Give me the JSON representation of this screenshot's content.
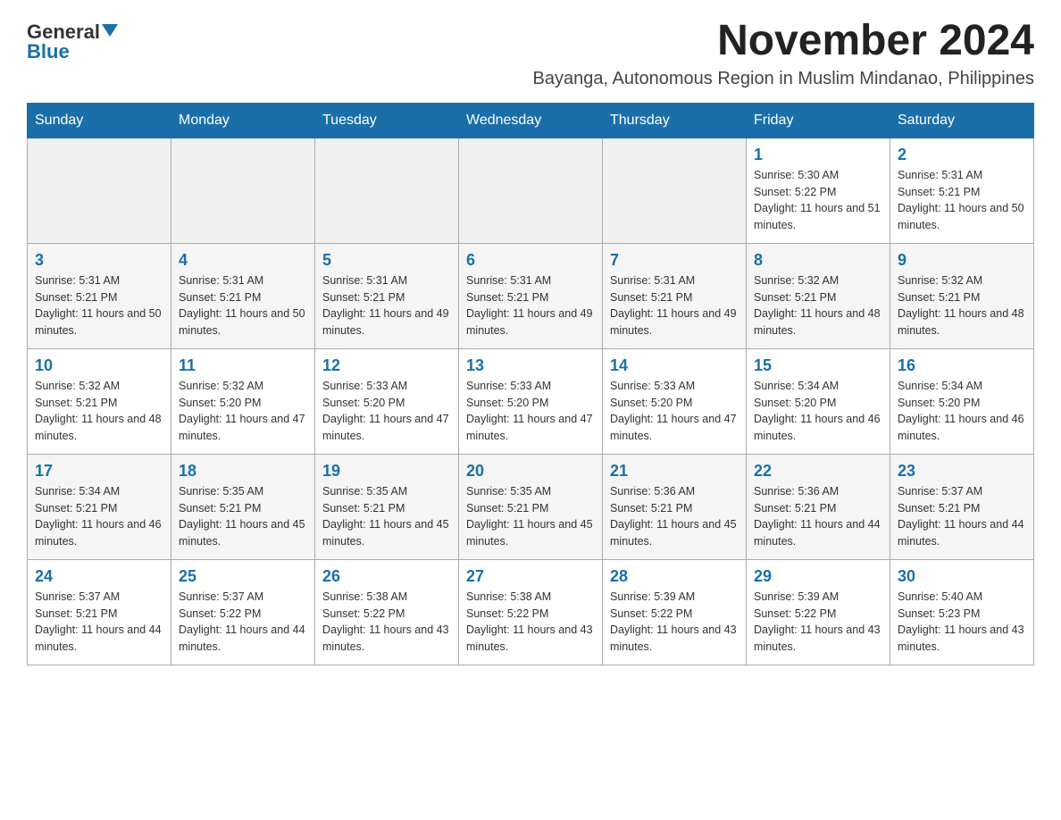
{
  "header": {
    "logo_general": "General",
    "logo_blue": "Blue",
    "title": "November 2024",
    "subtitle": "Bayanga, Autonomous Region in Muslim Mindanao, Philippines"
  },
  "weekdays": [
    "Sunday",
    "Monday",
    "Tuesday",
    "Wednesday",
    "Thursday",
    "Friday",
    "Saturday"
  ],
  "weeks": [
    [
      {
        "day": "",
        "info": ""
      },
      {
        "day": "",
        "info": ""
      },
      {
        "day": "",
        "info": ""
      },
      {
        "day": "",
        "info": ""
      },
      {
        "day": "",
        "info": ""
      },
      {
        "day": "1",
        "info": "Sunrise: 5:30 AM\nSunset: 5:22 PM\nDaylight: 11 hours and 51 minutes."
      },
      {
        "day": "2",
        "info": "Sunrise: 5:31 AM\nSunset: 5:21 PM\nDaylight: 11 hours and 50 minutes."
      }
    ],
    [
      {
        "day": "3",
        "info": "Sunrise: 5:31 AM\nSunset: 5:21 PM\nDaylight: 11 hours and 50 minutes."
      },
      {
        "day": "4",
        "info": "Sunrise: 5:31 AM\nSunset: 5:21 PM\nDaylight: 11 hours and 50 minutes."
      },
      {
        "day": "5",
        "info": "Sunrise: 5:31 AM\nSunset: 5:21 PM\nDaylight: 11 hours and 49 minutes."
      },
      {
        "day": "6",
        "info": "Sunrise: 5:31 AM\nSunset: 5:21 PM\nDaylight: 11 hours and 49 minutes."
      },
      {
        "day": "7",
        "info": "Sunrise: 5:31 AM\nSunset: 5:21 PM\nDaylight: 11 hours and 49 minutes."
      },
      {
        "day": "8",
        "info": "Sunrise: 5:32 AM\nSunset: 5:21 PM\nDaylight: 11 hours and 48 minutes."
      },
      {
        "day": "9",
        "info": "Sunrise: 5:32 AM\nSunset: 5:21 PM\nDaylight: 11 hours and 48 minutes."
      }
    ],
    [
      {
        "day": "10",
        "info": "Sunrise: 5:32 AM\nSunset: 5:21 PM\nDaylight: 11 hours and 48 minutes."
      },
      {
        "day": "11",
        "info": "Sunrise: 5:32 AM\nSunset: 5:20 PM\nDaylight: 11 hours and 47 minutes."
      },
      {
        "day": "12",
        "info": "Sunrise: 5:33 AM\nSunset: 5:20 PM\nDaylight: 11 hours and 47 minutes."
      },
      {
        "day": "13",
        "info": "Sunrise: 5:33 AM\nSunset: 5:20 PM\nDaylight: 11 hours and 47 minutes."
      },
      {
        "day": "14",
        "info": "Sunrise: 5:33 AM\nSunset: 5:20 PM\nDaylight: 11 hours and 47 minutes."
      },
      {
        "day": "15",
        "info": "Sunrise: 5:34 AM\nSunset: 5:20 PM\nDaylight: 11 hours and 46 minutes."
      },
      {
        "day": "16",
        "info": "Sunrise: 5:34 AM\nSunset: 5:20 PM\nDaylight: 11 hours and 46 minutes."
      }
    ],
    [
      {
        "day": "17",
        "info": "Sunrise: 5:34 AM\nSunset: 5:21 PM\nDaylight: 11 hours and 46 minutes."
      },
      {
        "day": "18",
        "info": "Sunrise: 5:35 AM\nSunset: 5:21 PM\nDaylight: 11 hours and 45 minutes."
      },
      {
        "day": "19",
        "info": "Sunrise: 5:35 AM\nSunset: 5:21 PM\nDaylight: 11 hours and 45 minutes."
      },
      {
        "day": "20",
        "info": "Sunrise: 5:35 AM\nSunset: 5:21 PM\nDaylight: 11 hours and 45 minutes."
      },
      {
        "day": "21",
        "info": "Sunrise: 5:36 AM\nSunset: 5:21 PM\nDaylight: 11 hours and 45 minutes."
      },
      {
        "day": "22",
        "info": "Sunrise: 5:36 AM\nSunset: 5:21 PM\nDaylight: 11 hours and 44 minutes."
      },
      {
        "day": "23",
        "info": "Sunrise: 5:37 AM\nSunset: 5:21 PM\nDaylight: 11 hours and 44 minutes."
      }
    ],
    [
      {
        "day": "24",
        "info": "Sunrise: 5:37 AM\nSunset: 5:21 PM\nDaylight: 11 hours and 44 minutes."
      },
      {
        "day": "25",
        "info": "Sunrise: 5:37 AM\nSunset: 5:22 PM\nDaylight: 11 hours and 44 minutes."
      },
      {
        "day": "26",
        "info": "Sunrise: 5:38 AM\nSunset: 5:22 PM\nDaylight: 11 hours and 43 minutes."
      },
      {
        "day": "27",
        "info": "Sunrise: 5:38 AM\nSunset: 5:22 PM\nDaylight: 11 hours and 43 minutes."
      },
      {
        "day": "28",
        "info": "Sunrise: 5:39 AM\nSunset: 5:22 PM\nDaylight: 11 hours and 43 minutes."
      },
      {
        "day": "29",
        "info": "Sunrise: 5:39 AM\nSunset: 5:22 PM\nDaylight: 11 hours and 43 minutes."
      },
      {
        "day": "30",
        "info": "Sunrise: 5:40 AM\nSunset: 5:23 PM\nDaylight: 11 hours and 43 minutes."
      }
    ]
  ]
}
